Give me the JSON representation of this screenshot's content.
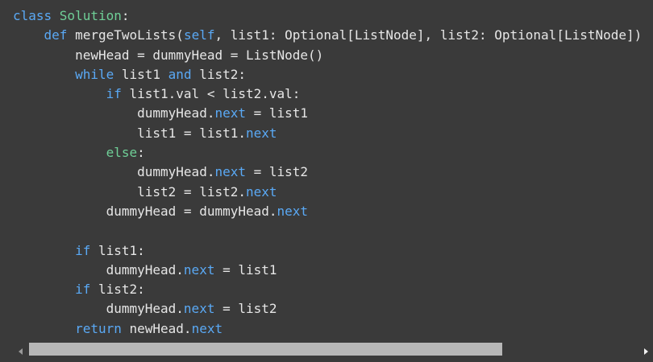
{
  "code": {
    "lines": [
      [
        {
          "t": "class ",
          "c": "keyword"
        },
        {
          "t": "Solution",
          "c": "class"
        },
        {
          "t": ":",
          "c": "plain"
        }
      ],
      [
        {
          "t": "    ",
          "c": "plain"
        },
        {
          "t": "def ",
          "c": "keyword"
        },
        {
          "t": "mergeTwoLists",
          "c": "func"
        },
        {
          "t": "(",
          "c": "plain"
        },
        {
          "t": "self",
          "c": "self"
        },
        {
          "t": ", list1: Optional[ListNode], list2: Optional[ListNode])",
          "c": "plain"
        }
      ],
      [
        {
          "t": "        newHead = dummyHead = ListNode()",
          "c": "plain"
        }
      ],
      [
        {
          "t": "        ",
          "c": "plain"
        },
        {
          "t": "while",
          "c": "keyword"
        },
        {
          "t": " list1 ",
          "c": "plain"
        },
        {
          "t": "and",
          "c": "keyword"
        },
        {
          "t": " list2:",
          "c": "plain"
        }
      ],
      [
        {
          "t": "            ",
          "c": "plain"
        },
        {
          "t": "if",
          "c": "keyword"
        },
        {
          "t": " list1.val < list2.val:",
          "c": "plain"
        }
      ],
      [
        {
          "t": "                dummyHead.",
          "c": "plain"
        },
        {
          "t": "next",
          "c": "attr"
        },
        {
          "t": " = list1",
          "c": "plain"
        }
      ],
      [
        {
          "t": "                list1 = list1.",
          "c": "plain"
        },
        {
          "t": "next",
          "c": "attr"
        }
      ],
      [
        {
          "t": "            ",
          "c": "plain"
        },
        {
          "t": "else",
          "c": "class"
        },
        {
          "t": ":",
          "c": "plain"
        }
      ],
      [
        {
          "t": "                dummyHead.",
          "c": "plain"
        },
        {
          "t": "next",
          "c": "attr"
        },
        {
          "t": " = list2",
          "c": "plain"
        }
      ],
      [
        {
          "t": "                list2 = list2.",
          "c": "plain"
        },
        {
          "t": "next",
          "c": "attr"
        }
      ],
      [
        {
          "t": "            dummyHead = dummyHead.",
          "c": "plain"
        },
        {
          "t": "next",
          "c": "attr"
        }
      ],
      [
        {
          "t": "",
          "c": "plain"
        }
      ],
      [
        {
          "t": "        ",
          "c": "plain"
        },
        {
          "t": "if",
          "c": "keyword"
        },
        {
          "t": " list1:",
          "c": "plain"
        }
      ],
      [
        {
          "t": "            dummyHead.",
          "c": "plain"
        },
        {
          "t": "next",
          "c": "attr"
        },
        {
          "t": " = list1",
          "c": "plain"
        }
      ],
      [
        {
          "t": "        ",
          "c": "plain"
        },
        {
          "t": "if",
          "c": "keyword"
        },
        {
          "t": " list2:",
          "c": "plain"
        }
      ],
      [
        {
          "t": "            dummyHead.",
          "c": "plain"
        },
        {
          "t": "next",
          "c": "attr"
        },
        {
          "t": " = list2",
          "c": "plain"
        }
      ],
      [
        {
          "t": "        ",
          "c": "plain"
        },
        {
          "t": "return",
          "c": "keyword"
        },
        {
          "t": " newHead.",
          "c": "plain"
        },
        {
          "t": "next",
          "c": "attr"
        }
      ]
    ]
  },
  "scrollbar": {
    "left_arrow_icon": "scroll-left-arrow-icon",
    "right_arrow_icon": "scroll-right-arrow-icon",
    "thumb_fraction": 0.78
  },
  "colors": {
    "background": "#3a3a3a",
    "keyword": "#5aa9f5",
    "class_name": "#6fcf97",
    "text": "#e6e6e6",
    "scroll_thumb": "#b7b7b7"
  }
}
